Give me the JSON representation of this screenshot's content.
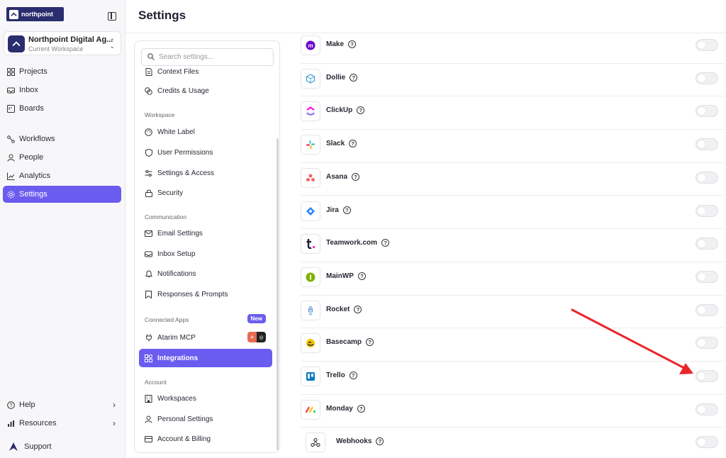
{
  "logo": {
    "text": "northpoint"
  },
  "workspace": {
    "name": "Northpoint Digital Ag...",
    "subtitle": "Current Workspace"
  },
  "nav": {
    "items": [
      {
        "label": "Projects",
        "icon": "grid-icon"
      },
      {
        "label": "Inbox",
        "icon": "inbox-icon"
      },
      {
        "label": "Boards",
        "icon": "board-icon"
      },
      {
        "label": "Workflows",
        "icon": "workflow-icon"
      },
      {
        "label": "People",
        "icon": "person-icon"
      },
      {
        "label": "Analytics",
        "icon": "chart-icon"
      },
      {
        "label": "Settings",
        "icon": "gear-icon",
        "active": true
      }
    ],
    "bottom": [
      {
        "label": "Help",
        "icon": "help-icon"
      },
      {
        "label": "Resources",
        "icon": "bars-icon"
      },
      {
        "label": "Support",
        "icon": "atarim-icon"
      }
    ]
  },
  "page": {
    "title": "Settings"
  },
  "settings_panel": {
    "search_placeholder": "Search settings...",
    "top_items": [
      "Context Files",
      "Credits & Usage"
    ],
    "sections": [
      {
        "heading": "Workspace",
        "items": [
          "White Label",
          "User Permissions",
          "Settings & Access",
          "Security"
        ]
      },
      {
        "heading": "Communication",
        "items": [
          "Email Settings",
          "Inbox Setup",
          "Notifications",
          "Responses & Prompts"
        ]
      },
      {
        "heading": "Connected Apps",
        "badge": "New",
        "items": [
          "Atarim MCP",
          "Integrations"
        ]
      },
      {
        "heading": "Account",
        "items": [
          "Workspaces",
          "Personal Settings",
          "Account & Billing"
        ]
      }
    ],
    "active_item": "Integrations"
  },
  "integrations": [
    {
      "name": "Make",
      "color": "#6d00cc"
    },
    {
      "name": "Dollie",
      "color": "#5aa7d8"
    },
    {
      "name": "ClickUp",
      "color": "#7b68ee"
    },
    {
      "name": "Slack",
      "color": "#e01e5a"
    },
    {
      "name": "Asana",
      "color": "#f06a6a"
    },
    {
      "name": "Jira",
      "color": "#2684ff"
    },
    {
      "name": "Teamwork.com",
      "color": "#1f1c3a"
    },
    {
      "name": "MainWP",
      "color": "#7fb100"
    },
    {
      "name": "Rocket",
      "color": "#5b8fd8"
    },
    {
      "name": "Basecamp",
      "color": "#f5c400"
    },
    {
      "name": "Trello",
      "color": "#0079bf"
    },
    {
      "name": "Monday",
      "color": "#ff3d57"
    },
    {
      "name": "Webhooks",
      "color": "#444444"
    }
  ],
  "colors": {
    "accent": "#6b5cf0",
    "arrow": "#e8262a"
  }
}
